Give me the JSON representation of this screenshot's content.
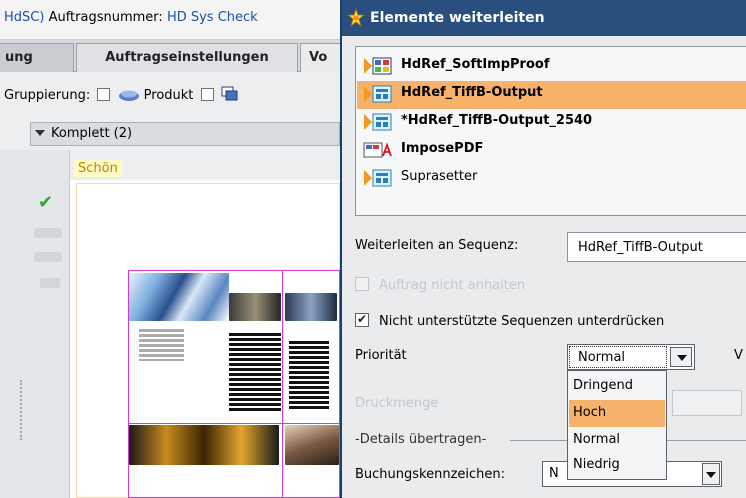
{
  "background": {
    "title_prefix": "HdSC)",
    "order_label": "Auftragsnummer:",
    "order_value": "HD Sys Check",
    "tabs": [
      "ung",
      "Auftragseinstellungen",
      "Vo"
    ],
    "grouping_label": "Gruppierung:",
    "grouping_option": "Produkt",
    "komplett_label": "Komplett (2)",
    "side_label": "Schön"
  },
  "dialog": {
    "title": "Elemente weiterleiten",
    "list_items": [
      {
        "label": "HdRef_SoftImpProof",
        "icon": "sequence-icon",
        "selected": false,
        "bold": true
      },
      {
        "label": "HdRef_TiffB-Output",
        "icon": "sequence-icon",
        "selected": true,
        "bold": true
      },
      {
        "label": "*HdRef_TiffB-Output_2540",
        "icon": "sequence-icon",
        "selected": false,
        "bold": true
      },
      {
        "label": "ImposePDF",
        "icon": "pdf-icon",
        "selected": false,
        "bold": true
      },
      {
        "label": "Suprasetter",
        "icon": "sequence-icon",
        "selected": false,
        "bold": false
      }
    ],
    "forward_label": "Weiterleiten an Sequenz:",
    "forward_value": "HdRef_TiffB-Output",
    "disabled_checkbox_label": "Auftrag nicht anhalten",
    "suppress_label": "Nicht unterstützte Sequenzen unterdrücken",
    "suppress_checked": true,
    "priority_label": "Priorität",
    "priority_value": "Normal",
    "priority_options": [
      "Dringend",
      "Hoch",
      "Normal",
      "Niedrig"
    ],
    "priority_highlighted": "Hoch",
    "right_cut_label": "V",
    "print_qty_label": "Druckmenge",
    "details_label": "Details übertragen",
    "booking_label": "Buchungskennzeichen:",
    "booking_value": "N"
  },
  "colors": {
    "title_bar": "#2a4f7e",
    "selection": "#f6b26b",
    "imposition_border": "#d23ad2"
  }
}
